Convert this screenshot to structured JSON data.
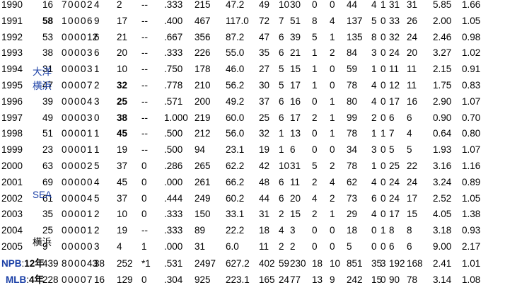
{
  "teams": {
    "taiyo": "大洋",
    "yokohama": "横浜",
    "seattle": "SEA",
    "yokohama_2004": "横浜"
  },
  "rows": [
    {
      "year": "1990",
      "cells": [
        "16",
        "7",
        "0",
        "0",
        "0",
        "2",
        "4",
        "2",
        "--",
        ".333",
        "215",
        "47.2",
        "49",
        "10",
        "30",
        "0",
        "0",
        "44",
        "4",
        "1",
        "31",
        "31",
        "5.85",
        "1.66"
      ]
    },
    {
      "year": "1991",
      "cells": [
        "58",
        "1",
        "0",
        "0",
        "0",
        "6",
        "9",
        "17",
        "--",
        ".400",
        "467",
        "117.0",
        "72",
        "7",
        "51",
        "8",
        "4",
        "137",
        "5",
        "0",
        "33",
        "26",
        "2.00",
        "1.05"
      ],
      "bold": [
        0
      ]
    },
    {
      "year": "1992",
      "cells": [
        "53",
        "0",
        "0",
        "0",
        "0",
        "12",
        "6",
        "21",
        "--",
        ".667",
        "356",
        "87.2",
        "47",
        "6",
        "39",
        "5",
        "1",
        "135",
        "8",
        "0",
        "32",
        "24",
        "2.46",
        "0.98"
      ]
    },
    {
      "year": "1993",
      "cells": [
        "38",
        "0",
        "0",
        "0",
        "0",
        "3",
        "6",
        "20",
        "--",
        ".333",
        "226",
        "55.0",
        "35",
        "6",
        "21",
        "1",
        "2",
        "84",
        "3",
        "0",
        "24",
        "20",
        "3.27",
        "1.02"
      ]
    },
    {
      "year": "1994",
      "cells": [
        "31",
        "0",
        "0",
        "0",
        "0",
        "3",
        "1",
        "10",
        "--",
        ".750",
        "178",
        "46.0",
        "27",
        "5",
        "15",
        "1",
        "0",
        "59",
        "1",
        "0",
        "11",
        "11",
        "2.15",
        "0.91"
      ]
    },
    {
      "year": "1995",
      "cells": [
        "47",
        "0",
        "0",
        "0",
        "0",
        "7",
        "2",
        "32",
        "--",
        ".778",
        "210",
        "56.2",
        "30",
        "5",
        "17",
        "1",
        "0",
        "78",
        "4",
        "0",
        "12",
        "11",
        "1.75",
        "0.83"
      ],
      "bold": [
        7
      ]
    },
    {
      "year": "1996",
      "cells": [
        "39",
        "0",
        "0",
        "0",
        "0",
        "4",
        "3",
        "25",
        "--",
        ".571",
        "200",
        "49.2",
        "37",
        "6",
        "16",
        "0",
        "1",
        "80",
        "4",
        "0",
        "17",
        "16",
        "2.90",
        "1.07"
      ],
      "bold": [
        7
      ]
    },
    {
      "year": "1997",
      "cells": [
        "49",
        "0",
        "0",
        "0",
        "0",
        "3",
        "0",
        "38",
        "--",
        "1.000",
        "219",
        "60.0",
        "25",
        "6",
        "17",
        "2",
        "1",
        "99",
        "2",
        "0",
        "6",
        "6",
        "0.90",
        "0.70"
      ],
      "bold": [
        7
      ]
    },
    {
      "year": "1998",
      "cells": [
        "51",
        "0",
        "0",
        "0",
        "0",
        "1",
        "1",
        "45",
        "--",
        ".500",
        "212",
        "56.0",
        "32",
        "1",
        "13",
        "0",
        "1",
        "78",
        "1",
        "1",
        "7",
        "4",
        "0.64",
        "0.80"
      ],
      "bold": [
        7
      ]
    },
    {
      "year": "1999",
      "cells": [
        "23",
        "0",
        "0",
        "0",
        "0",
        "1",
        "1",
        "19",
        "--",
        ".500",
        "94",
        "23.1",
        "19",
        "1",
        "6",
        "0",
        "0",
        "34",
        "3",
        "0",
        "5",
        "5",
        "1.93",
        "1.07"
      ]
    },
    {
      "year": "2000",
      "cells": [
        "63",
        "0",
        "0",
        "0",
        "0",
        "2",
        "5",
        "37",
        "0",
        ".286",
        "265",
        "62.2",
        "42",
        "10",
        "31",
        "5",
        "2",
        "78",
        "1",
        "0",
        "25",
        "22",
        "3.16",
        "1.16"
      ]
    },
    {
      "year": "2001",
      "cells": [
        "69",
        "0",
        "0",
        "0",
        "0",
        "0",
        "4",
        "45",
        "0",
        ".000",
        "261",
        "66.2",
        "48",
        "6",
        "11",
        "2",
        "4",
        "62",
        "4",
        "0",
        "24",
        "24",
        "3.24",
        "0.89"
      ]
    },
    {
      "year": "2002",
      "cells": [
        "61",
        "0",
        "0",
        "0",
        "0",
        "4",
        "5",
        "37",
        "0",
        ".444",
        "249",
        "60.2",
        "44",
        "6",
        "20",
        "4",
        "2",
        "73",
        "6",
        "0",
        "24",
        "17",
        "2.52",
        "1.05"
      ]
    },
    {
      "year": "2003",
      "cells": [
        "35",
        "0",
        "0",
        "0",
        "0",
        "1",
        "2",
        "10",
        "0",
        ".333",
        "150",
        "33.1",
        "31",
        "2",
        "15",
        "2",
        "1",
        "29",
        "4",
        "0",
        "17",
        "15",
        "4.05",
        "1.38"
      ]
    },
    {
      "year": "2004",
      "cells": [
        "25",
        "0",
        "0",
        "0",
        "0",
        "1",
        "2",
        "19",
        "--",
        ".333",
        "89",
        "22.2",
        "18",
        "4",
        "3",
        "0",
        "0",
        "18",
        "0",
        "1",
        "8",
        "8",
        "3.18",
        "0.93"
      ]
    },
    {
      "year": "2005",
      "cells": [
        "9",
        "0",
        "0",
        "0",
        "0",
        "0",
        "3",
        "4",
        "1",
        ".000",
        "31",
        "6.0",
        "11",
        "2",
        "2",
        "0",
        "0",
        "5",
        "0",
        "0",
        "6",
        "6",
        "9.00",
        "2.17"
      ]
    }
  ],
  "totals": [
    {
      "label": "NPB",
      "years": "12年",
      "cells": [
        "439",
        "8",
        "0",
        "0",
        "0",
        "43",
        "38",
        "252",
        "*1",
        ".531",
        "2497",
        "627.2",
        "402",
        "59",
        "230",
        "18",
        "10",
        "851",
        "35",
        "3",
        "192",
        "168",
        "2.41",
        "1.01"
      ]
    },
    {
      "label": "MLB",
      "years": "4年",
      "cells": [
        "228",
        "0",
        "0",
        "0",
        "0",
        "7",
        "16",
        "129",
        "0",
        ".304",
        "925",
        "223.1",
        "165",
        "24",
        "77",
        "13",
        "9",
        "242",
        "15",
        "0",
        "90",
        "78",
        "3.14",
        "1.08"
      ]
    }
  ],
  "totals_separator": ":"
}
